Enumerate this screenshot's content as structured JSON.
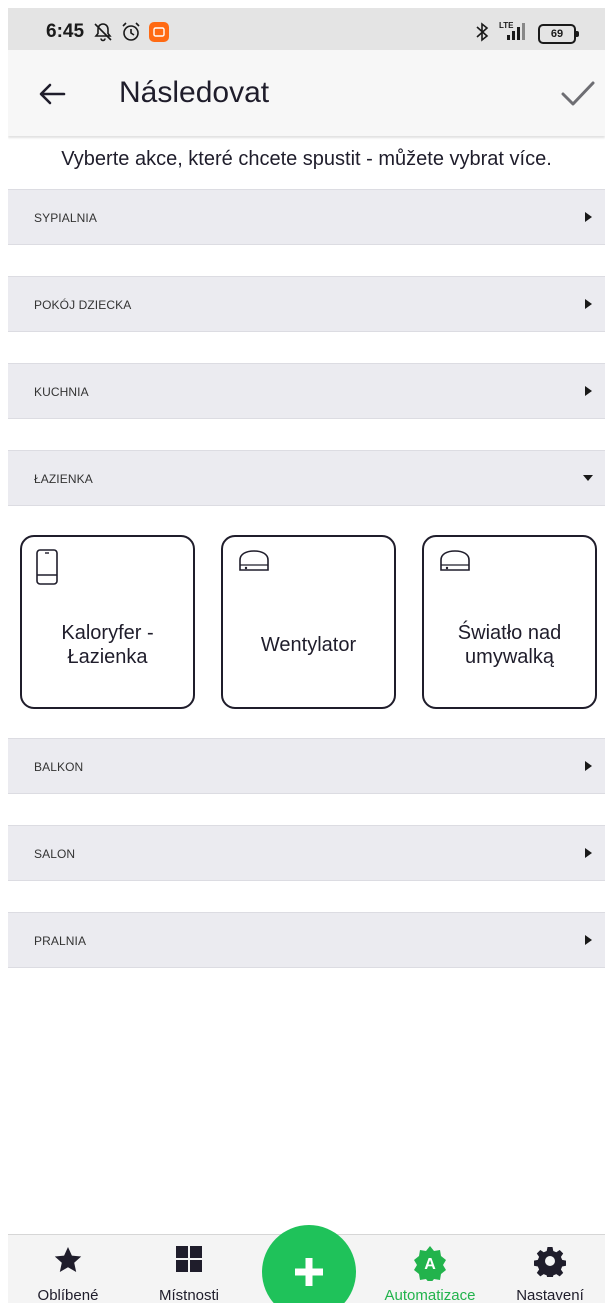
{
  "status_bar": {
    "time": "6:45",
    "battery": "69",
    "network": "LTE"
  },
  "header": {
    "title": "Následovat"
  },
  "instruction": "Vyberte akce, které chcete spustit - můžete vybrat více.",
  "rooms": [
    {
      "label": "SYPIALNIA",
      "expanded": false
    },
    {
      "label": "POKÓJ DZIECKA",
      "expanded": false
    },
    {
      "label": "KUCHNIA",
      "expanded": false
    },
    {
      "label": "ŁAZIENKA",
      "expanded": true
    },
    {
      "label": "BALKON",
      "expanded": false
    },
    {
      "label": "SALON",
      "expanded": false
    },
    {
      "label": "PRALNIA",
      "expanded": false
    }
  ],
  "devices": [
    {
      "label": "Kaloryfer - Łazienka",
      "icon": "radiator-icon"
    },
    {
      "label": "Wentylator",
      "icon": "relay-module-icon"
    },
    {
      "label": "Światło nad umywalką",
      "icon": "relay-module-icon"
    }
  ],
  "bottom_nav": [
    {
      "label": "Oblíbené",
      "icon": "star-icon"
    },
    {
      "label": "Místnosti",
      "icon": "grid-icon"
    },
    {
      "label": "Automatizace",
      "icon": "automation-badge-icon",
      "active": true,
      "badge": "A"
    },
    {
      "label": "Nastavení",
      "icon": "gear-icon"
    }
  ],
  "colors": {
    "accent": "#1fc25a",
    "active_label": "#22b34c",
    "section_bg": "#ebebf0",
    "text": "#1f1d2b"
  }
}
